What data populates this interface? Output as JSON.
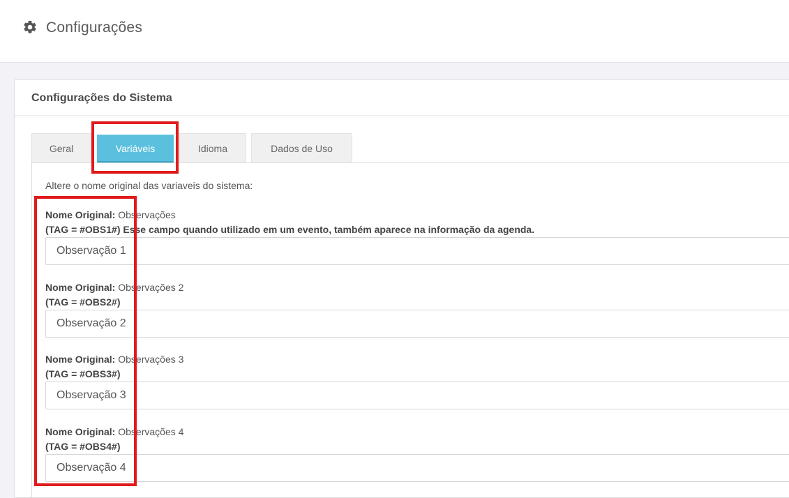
{
  "header": {
    "title": "Configurações",
    "icon": "gear-icon"
  },
  "panel": {
    "title": "Configurações do Sistema"
  },
  "tabs": [
    {
      "label": "Geral",
      "active": false
    },
    {
      "label": "Variáveis",
      "active": true
    },
    {
      "label": "Idioma",
      "active": false
    },
    {
      "label": "Dados de Uso",
      "active": false
    }
  ],
  "content": {
    "intro": "Altere o nome original das variaveis do sistema:",
    "fields": [
      {
        "label": "Nome Original:",
        "original": "Observações",
        "tag": "(TAG = #OBS1#) Esse campo quando utilizado em um evento, também aparece na informação da agenda.",
        "value": "Observação 1"
      },
      {
        "label": "Nome Original:",
        "original": "Observações 2",
        "tag": "(TAG = #OBS2#)",
        "value": "Observação 2"
      },
      {
        "label": "Nome Original:",
        "original": "Observações 3",
        "tag": "(TAG = #OBS3#)",
        "value": "Observação 3"
      },
      {
        "label": "Nome Original:",
        "original": "Observações 4",
        "tag": "(TAG = #OBS4#)",
        "value": "Observação 4"
      }
    ]
  },
  "colors": {
    "active_tab": "#5bc0de",
    "highlight": "#e01b1b"
  }
}
